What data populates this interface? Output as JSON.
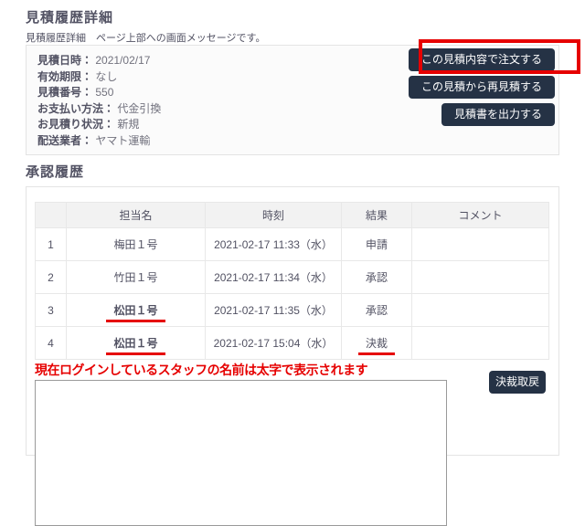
{
  "page": {
    "title": "見積履歴詳細",
    "subtitle": "見積履歴詳細　ページ上部への画面メッセージです。"
  },
  "quote": {
    "fields": [
      {
        "label": "見積日時：",
        "value": "2021/02/17"
      },
      {
        "label": "有効期限：",
        "value": "なし"
      },
      {
        "label": "見積番号：",
        "value": "550"
      },
      {
        "label": "お支払い方法：",
        "value": "代金引換"
      },
      {
        "label": "お見積り状況：",
        "value": "新規"
      },
      {
        "label": "配送業者：",
        "value": "ヤマト運輸"
      }
    ],
    "actions": {
      "order": "この見積内容で注文する",
      "requote": "この見積から再見積する",
      "export": "見積書を出力する"
    }
  },
  "approval": {
    "section_title": "承認履歴",
    "table": {
      "headers": {
        "no": "",
        "name": "担当名",
        "time": "時刻",
        "result": "結果",
        "comment": "コメント"
      },
      "rows": [
        {
          "no": "1",
          "name": "梅田１号",
          "time": "2021-02-17 11:33（水）",
          "result": "申請",
          "comment": ""
        },
        {
          "no": "2",
          "name": "竹田１号",
          "time": "2021-02-17 11:34（水）",
          "result": "承認",
          "comment": ""
        },
        {
          "no": "3",
          "name": "松田１号",
          "time": "2021-02-17 11:35（水）",
          "result": "承認",
          "comment": ""
        },
        {
          "no": "4",
          "name": "松田１号",
          "time": "2021-02-17 15:04（水）",
          "result": "決裁",
          "comment": ""
        }
      ]
    },
    "revoke_button": "決裁取戻"
  },
  "annotations": {
    "note": "現在ログインしているスタッフの名前は太字で表示されます"
  },
  "colors": {
    "button_bg": "#253245",
    "accent_red": "#e60000",
    "header_bg": "#f2f2f2"
  }
}
